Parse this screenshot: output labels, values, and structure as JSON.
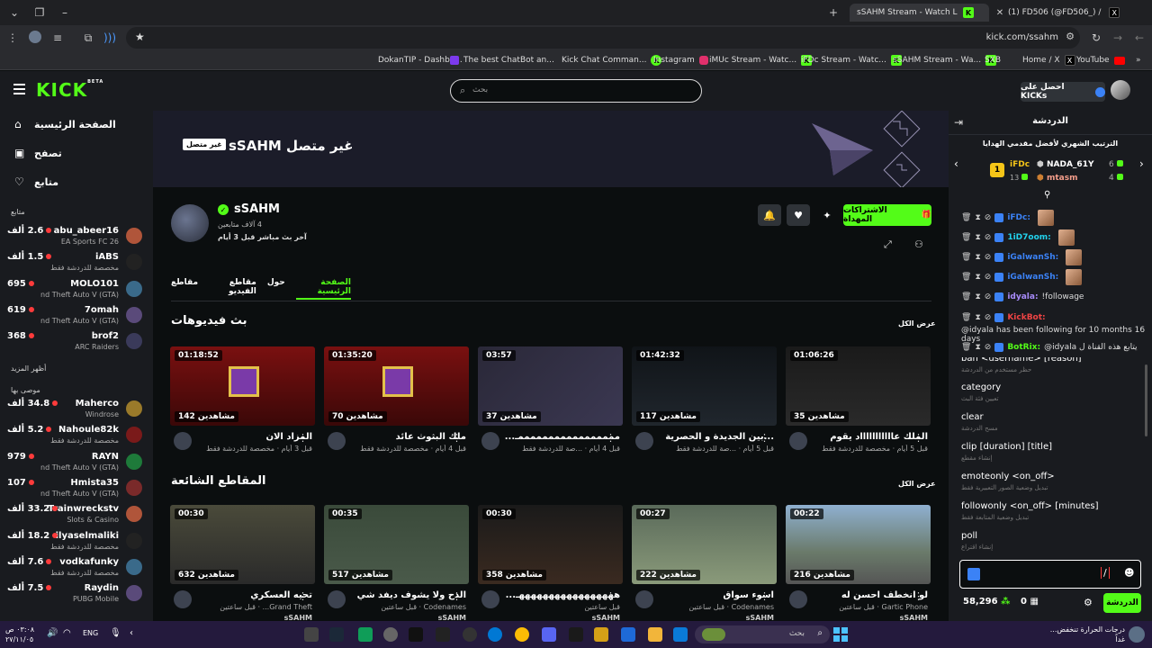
{
  "browser": {
    "tabs": [
      {
        "title": "sSAHM Stream - Watch Live on"
      },
      {
        "title": "(1) FD506 (@FD506_) / X"
      }
    ],
    "url": "kick.com/ssahm",
    "bookmarks": [
      "DokanTIP - Dashbo...",
      "The best ChatBot an...",
      "Kick Chat Comman...",
      "Instagram",
      "iMUc Stream - Watc...",
      "iFDc Stream - Watc...",
      "sSAHM Stream - Wa...",
      "SXB",
      "Home / X",
      "YouTube"
    ]
  },
  "kick": {
    "logo": "KICK",
    "logo_beta": "BETA",
    "search_placeholder": "بحث",
    "get_kicks": "احصل على KICKs"
  },
  "sidebar": {
    "nav": [
      {
        "label": "الصفحة الرئيسية",
        "icon": "home-icon"
      },
      {
        "label": "تصفح",
        "icon": "browse-icon"
      },
      {
        "label": "متابع",
        "icon": "heart-icon"
      }
    ],
    "following_title": "متابع",
    "following": [
      {
        "name": "abu_abeer16",
        "sub": "EA Sports FC 26",
        "count": "2.6 ألف"
      },
      {
        "name": "iABS",
        "sub": "مخصصة للدردشة فقط",
        "count": "1.5 ألف"
      },
      {
        "name": "MOLO101",
        "sub": "nd Theft Auto V (GTA)",
        "count": "695"
      },
      {
        "name": "7omah",
        "sub": "nd Theft Auto V (GTA)",
        "count": "619"
      },
      {
        "name": "brof2",
        "sub": "ARC Raiders",
        "count": "368"
      }
    ],
    "show_more": "أظهر المزيد",
    "recommended_title": "موصى بها",
    "recommended": [
      {
        "name": "Maherco",
        "sub": "Windrose",
        "count": "34.8 ألف"
      },
      {
        "name": "Nahoule82k",
        "sub": "مخصصة للدردشة فقط",
        "count": "5.2 ألف"
      },
      {
        "name": "RAYN",
        "sub": "nd Theft Auto V (GTA)",
        "count": "979"
      },
      {
        "name": "Hmista35",
        "sub": "nd Theft Auto V (GTA)",
        "count": "107"
      },
      {
        "name": "Trainwreckstv",
        "sub": "Slots & Casino",
        "count": "33.2 ألف"
      },
      {
        "name": "ilyaselmaliki",
        "sub": "مخصصة للدردشة فقط",
        "count": "18.2 ألف"
      },
      {
        "name": "vodkafunky",
        "sub": "مخصصة للدردشة فقط",
        "count": "7.6 ألف"
      },
      {
        "name": "Raydin",
        "sub": "PUBG Mobile",
        "count": "7.5 ألف"
      }
    ]
  },
  "channel": {
    "banner_title": "غير متصل sSAHM",
    "offline_badge": "غير متصل",
    "name": "sSAHM",
    "followers": "4 آلاف متابعين",
    "last_live": "آخر بث مباشر قبل 3 أيام",
    "gift_subs": "الاشتراكات المهداة",
    "tabs": [
      "الصفحة الرئيسية",
      "حول",
      "مقاطع الفيديو",
      "مقاطع"
    ],
    "videos_title": "بث فيديوهات",
    "clips_title": "المقاطع الشائعة",
    "view_all": "عرض الكل",
    "videos": [
      {
        "duration": "01:06:26",
        "views": "35 مشاهدين",
        "title": "الملك عاااااااااااد يقوم",
        "meta": "قبل 5 أيام · مخصصة للدردشة فقط"
      },
      {
        "duration": "01:42:32",
        "views": "117 مشاهدين",
        "title": "...بين الجديدة و الحصرية",
        "meta": "قبل 5 أيام · ...صة للدردشة فقط"
      },
      {
        "duration": "03:57",
        "views": "37 مشاهدين",
        "title": "مممممممممممممممممـ...",
        "meta": "قبل 4 أيام · ...صة للدردشة فقط"
      },
      {
        "duration": "01:35:20",
        "views": "70 مشاهدين",
        "title": "ملك البثوث عائد",
        "meta": "قبل 4 أيام · مخصصة للدردشة فقط"
      },
      {
        "duration": "01:18:52",
        "views": "142 مشاهدين",
        "title": "المزاد الان",
        "meta": "قبل 3 أيام · مخصصة للدردشة فقط"
      }
    ],
    "clips": [
      {
        "duration": "00:22",
        "views": "216 مشاهدين",
        "title": "لو انخطف احسن له",
        "meta": "Gartic Phone · قبل ساعتين",
        "by": "sSAHM"
      },
      {
        "duration": "00:27",
        "views": "222 مشاهدين",
        "title": "اسوء سواق",
        "meta": "Codenames · قبل ساعتين",
        "by": "sSAHM"
      },
      {
        "duration": "00:30",
        "views": "358 مشاهدين",
        "title": "هههههههههههههههههـ...",
        "meta": "قبل ساعتين",
        "by": "sSAHM"
      },
      {
        "duration": "00:35",
        "views": "517 مشاهدين",
        "title": "الدح ولا يشوف ديفد شي",
        "meta": "Codenames · قبل ساعتين",
        "by": "sSAHM"
      },
      {
        "duration": "00:30",
        "views": "632 مشاهدين",
        "title": "تحيه العسكري",
        "meta": "Grand Theft... · قبل ساعتين",
        "by": "sSAHM"
      }
    ]
  },
  "chat": {
    "title": "الدردشة",
    "leaderboard_title": "الترتيب الشهري لأفضل مقدمي الهدايا",
    "leaders": [
      {
        "name": "iFDc",
        "count": "13"
      },
      {
        "name": "NADA_61Y",
        "count": "6"
      },
      {
        "name": "mtasm",
        "count": "4"
      }
    ],
    "messages": [
      {
        "user": "iFDc:",
        "text": "",
        "color": "#3b82f6"
      },
      {
        "user": "1iD7oom:",
        "text": "",
        "color": "#22d3ee"
      },
      {
        "user": "iGalwanSh:",
        "text": "",
        "color": "#3b82f6"
      },
      {
        "user": "iGalwanSh:",
        "text": "",
        "color": "#3b82f6"
      },
      {
        "user": "idyala:",
        "text": "!followage",
        "color": "#a78bfa"
      },
      {
        "user": "KickBot:",
        "text": "@idyala has been following for 10 months 16 days",
        "color": "#ef4444"
      },
      {
        "user": "BotRix:",
        "text": "@idyala يتابع هذه القناة ل",
        "color": "#53fc18"
      }
    ],
    "commands": [
      {
        "cmd": "ban <username> [reason]",
        "desc": "حظر مستخدم من الدردشة"
      },
      {
        "cmd": "category",
        "desc": "تعيين فئة البث"
      },
      {
        "cmd": "clear",
        "desc": "مسح الدردشة"
      },
      {
        "cmd": "clip [duration] [title]",
        "desc": "إنشاء مقطع"
      },
      {
        "cmd": "emoteonly <on_off>",
        "desc": "تبديل وضعية الصور التعبيرية فقط"
      },
      {
        "cmd": "followonly <on_off> [minutes]",
        "desc": "تبديل وضعية المتابعة فقط"
      },
      {
        "cmd": "poll",
        "desc": "إنشاء اقتراع"
      }
    ],
    "input_value": "/",
    "points": "58,296",
    "gifts": "0",
    "send_label": "الدردشة"
  },
  "taskbar": {
    "search": "بحث",
    "weather": "درجات الحرارة تنخفض...",
    "weather_sub": "غداً",
    "lang": "ENG",
    "time": "٠٣:٠٨ ص",
    "date": "٢٧/١١/٠٥"
  }
}
